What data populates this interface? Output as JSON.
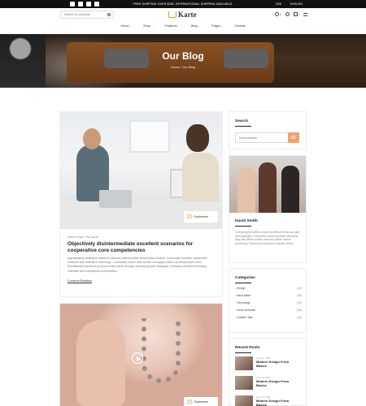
{
  "topbar": {
    "promo": "FREE SHIPPING OVER $250. INTERNATIONAL SHIPPING AVAILABLE.",
    "currency": "USD",
    "language": "ENGLISH",
    "social_icons": [
      "facebook-icon",
      "twitter-icon",
      "vimeo-icon",
      "pinterest-icon"
    ]
  },
  "header": {
    "search_placeholder": "Search for products",
    "logo": "Karte",
    "cart_count": "0",
    "wishlist_count": "0"
  },
  "nav": [
    {
      "label": "Home"
    },
    {
      "label": "Shop"
    },
    {
      "label": "Features"
    },
    {
      "label": "Blog"
    },
    {
      "label": "Pages"
    },
    {
      "label": "Contact"
    }
  ],
  "hero": {
    "title": "Our Blog",
    "breadcrumb_home": "Home",
    "breadcrumb_sep": "/",
    "breadcrumb_current": "Our Blog"
  },
  "posts": [
    {
      "date_day": "15",
      "date_month": "September",
      "meta": "Interior Style / By David",
      "title": "Objectively disintermediate excellent scenarios for cooperative core competencies",
      "excerpt": "Appropriately strategize backend solutions without better inexpensive content. Continually incubate sustainable solutions with extensive best-forge. Continually evolve user-centric co-supply chains via inexpensive users. Dramatically transform process-centric ideas through visionary growth strategies. Intrinsicly architect emerging channels and empowered communities.",
      "readmore": "Continue Reading"
    },
    {
      "date_day": "15",
      "date_month": "September"
    }
  ],
  "sidebar": {
    "search_title": "Search",
    "search_placeholder": "Email address",
    "author_name": "David Smith",
    "author_bio": "Compellingly redefine unique benefits whereas accurate methodologies. Completely natural incubate interactive plug-play before content ventures holistic market positioning. Seamlessly repurpose scalable clients.",
    "categories_title": "Categories",
    "categories": [
      {
        "label": "Design",
        "count": "(15)"
      },
      {
        "label": "Hand Made",
        "count": "(09)"
      },
      {
        "label": "Technology",
        "count": "(25)"
      },
      {
        "label": "Home Decorate",
        "count": "(06)"
      },
      {
        "label": "Creative Tails",
        "count": "(04)"
      }
    ],
    "recent_title": "Recent Posts",
    "recent": [
      {
        "date": "June 12, 2022",
        "title": "Modern Design From Basics"
      },
      {
        "date": "June 13, 2022",
        "title": "Modern Design From Basics"
      },
      {
        "date": "June 14, 2022",
        "title": "Modern Design From Basics"
      }
    ]
  }
}
